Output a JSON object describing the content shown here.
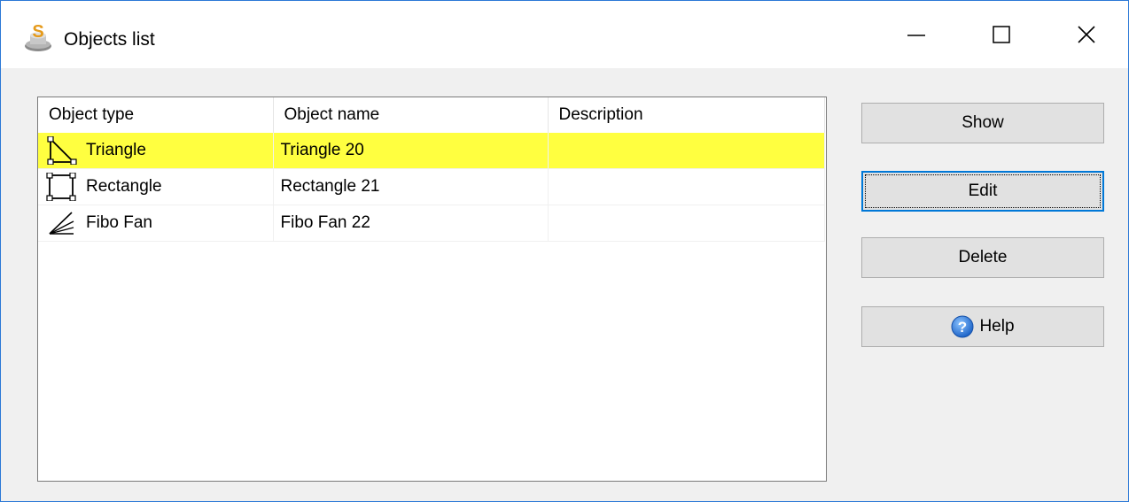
{
  "window": {
    "title": "Objects list",
    "controls": {
      "minimize": "minimize-icon",
      "maximize": "maximize-icon",
      "close": "close-icon"
    }
  },
  "table": {
    "columns": [
      "Object type",
      "Object name",
      "Description"
    ],
    "rows": [
      {
        "icon": "triangle-icon",
        "type": "Triangle",
        "name": "Triangle 20",
        "description": "",
        "selected": true
      },
      {
        "icon": "rectangle-icon",
        "type": "Rectangle",
        "name": "Rectangle 21",
        "description": "",
        "selected": false
      },
      {
        "icon": "fibo-fan-icon",
        "type": "Fibo Fan",
        "name": "Fibo Fan 22",
        "description": "",
        "selected": false
      }
    ],
    "selection_color": "#ffff40"
  },
  "buttons": {
    "show": "Show",
    "edit": "Edit",
    "delete": "Delete",
    "help": "Help",
    "focused": "Edit"
  },
  "colors": {
    "window_border": "#2b78d6",
    "dialog_bg": "#f0f0f0",
    "button_bg": "#e1e1e1",
    "focus_border": "#0078d7"
  }
}
